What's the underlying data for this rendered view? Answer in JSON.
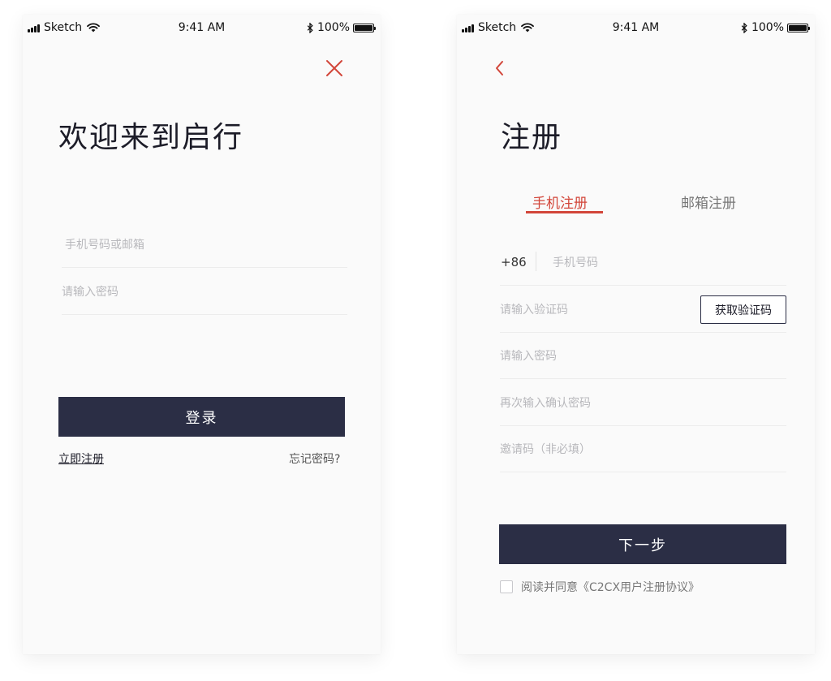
{
  "status_bar": {
    "carrier": "Sketch",
    "time": "9:41 AM",
    "battery": "100%"
  },
  "login": {
    "title": "欢迎来到启行",
    "account_placeholder": "手机号码或邮箱",
    "password_placeholder": "请输入密码",
    "login_button": "登录",
    "register_link": "立即注册",
    "forgot_link": "忘记密码?"
  },
  "register": {
    "title": "注册",
    "tabs": [
      {
        "label": "手机注册",
        "active": true
      },
      {
        "label": "邮箱注册",
        "active": false
      }
    ],
    "country_code": "+86",
    "phone_placeholder": "手机号码",
    "code_placeholder": "请输入验证码",
    "get_code_button": "获取验证码",
    "password_placeholder": "请输入密码",
    "confirm_placeholder": "再次输入确认密码",
    "invite_placeholder": "邀请码（非必填）",
    "next_button": "下一步",
    "agreement_text": "阅读并同意《C2CX用户注册协议》"
  },
  "icons": {
    "close": "close-icon",
    "back": "chevron-left-icon"
  },
  "colors": {
    "accent": "#d2463a",
    "primary_button": "#2b2e45",
    "background": "#fafafa"
  }
}
